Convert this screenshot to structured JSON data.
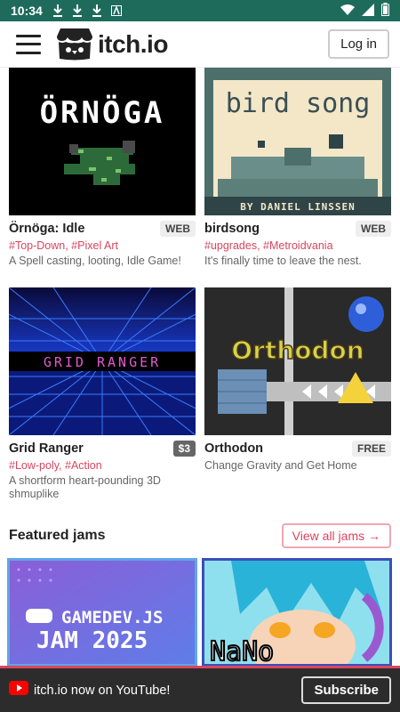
{
  "status": {
    "time": "10:34"
  },
  "header": {
    "logo": "itch.io",
    "login_label": "Log in"
  },
  "games": [
    {
      "title": "Örnöga: Idle",
      "badge": "WEB",
      "tags": "#Top-Down, #Pixel Art",
      "desc": "A Spell casting, looting, Idle Game!",
      "art": "ÖRNÖGA"
    },
    {
      "title": "birdsong",
      "badge": "WEB",
      "tags": "#upgrades, #Metroidvania",
      "desc": "It's finally time to leave the nest.",
      "art_title": "bird song",
      "art_author": "BY DANIEL LINSSEN"
    },
    {
      "title": "Grid Ranger",
      "badge": "$3",
      "tags": "#Low-poly, #Action",
      "desc": "A shortform heart-pounding 3D shmuplike",
      "art": "GRID RANGER"
    },
    {
      "title": "Orthodon",
      "badge": "FREE",
      "tags": "",
      "desc": "Change Gravity and Get Home",
      "art": "Orthodon"
    }
  ],
  "jams": {
    "title": "Featured jams",
    "view_all": "View all jams →",
    "items": [
      {
        "line1": "GAMEDEV.JS",
        "line2": "JAM 2025"
      },
      {
        "line1": "NaNo"
      }
    ]
  },
  "banner": {
    "text": "itch.io now on YouTube!",
    "subscribe": "Subscribe"
  }
}
